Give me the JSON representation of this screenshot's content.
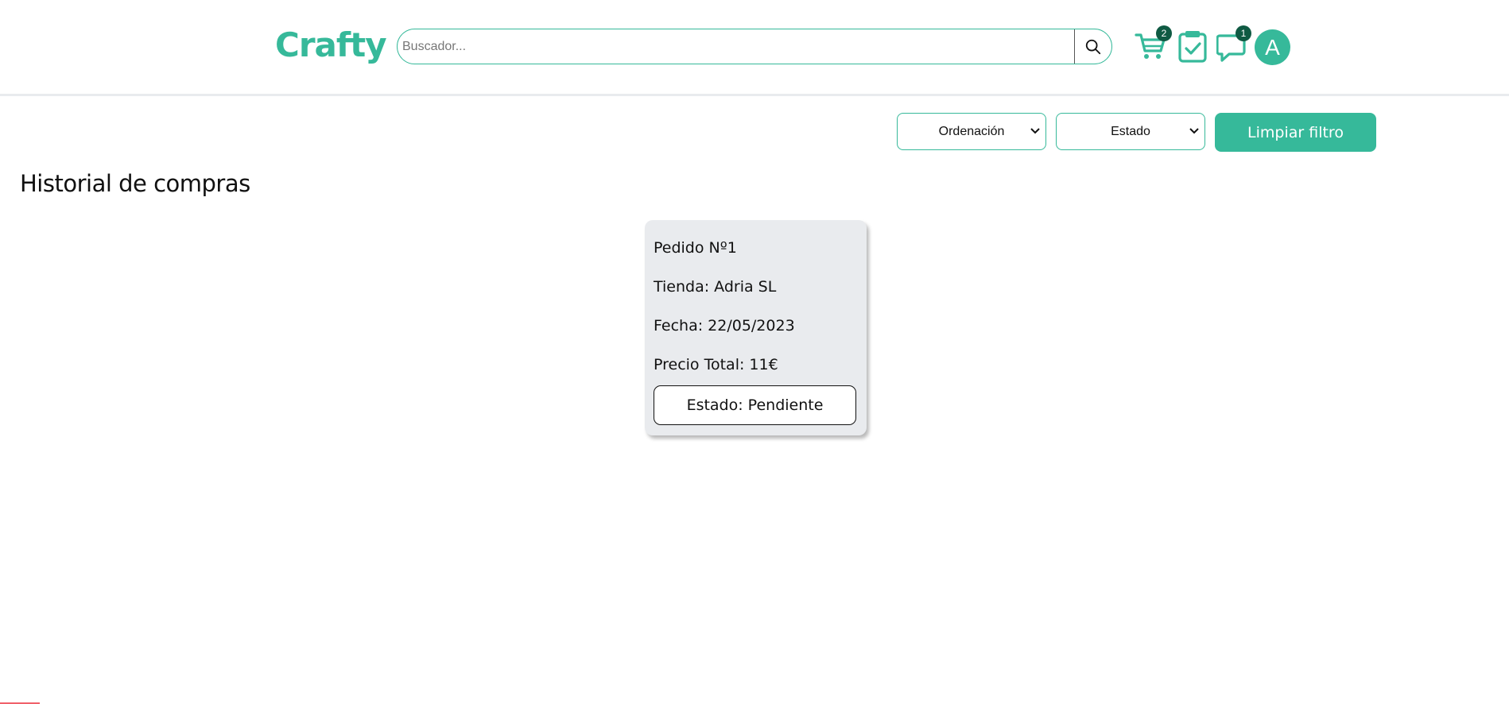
{
  "header": {
    "logo": "Crafty",
    "search_placeholder": "Buscador...",
    "cart_count": "2",
    "messages_count": "1",
    "avatar_initial": "A"
  },
  "filters": {
    "sort_label": "Ordenación",
    "status_label": "Estado",
    "clear_label": "Limpiar filtro"
  },
  "page_title": "Historial de compras",
  "orders": [
    {
      "order": "Pedido Nº1",
      "store": "Tienda: Adria SL",
      "date": "Fecha: 22/05/2023",
      "total": "Precio Total: 11€",
      "status": "Estado: Pendiente"
    }
  ],
  "colors": {
    "accent": "#36b99a",
    "badge": "#0f5a43",
    "card_bg": "#e9ebee"
  },
  "icons": [
    "search-icon",
    "cart-icon",
    "clipboard-check-icon",
    "chat-icon",
    "chevron-down-icon"
  ]
}
